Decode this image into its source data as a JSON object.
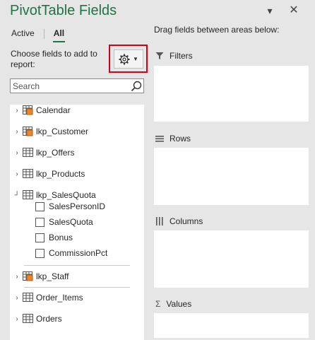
{
  "header": {
    "title": "PivotTable Fields",
    "collapse_icon": "▾",
    "close_icon": "✕"
  },
  "tabs": [
    {
      "label": "Active",
      "active": false
    },
    {
      "label": "All",
      "active": true
    }
  ],
  "choose_label": "Choose fields to add to report:",
  "search": {
    "placeholder": "Search"
  },
  "fields": [
    {
      "name": "Calendar",
      "expander": "›",
      "icon": "table-linked"
    },
    {
      "name": "lkp_Customer",
      "expander": "›",
      "icon": "table-linked"
    },
    {
      "name": "lkp_Offers",
      "expander": "›",
      "icon": "table"
    },
    {
      "name": "lkp_Products",
      "expander": "›",
      "icon": "table"
    },
    {
      "name": "lkp_SalesQuota",
      "expander": "┘",
      "icon": "table",
      "subfields": [
        "SalesPersonID",
        "SalesQuota",
        "Bonus",
        "CommissionPct"
      ]
    },
    {
      "name": "lkp_Staff",
      "expander": "›",
      "icon": "table-linked"
    },
    {
      "name": "Order_Items",
      "expander": "›",
      "icon": "table"
    },
    {
      "name": "Orders",
      "expander": "›",
      "icon": "table"
    }
  ],
  "areas": {
    "instruction": "Drag fields between areas below:",
    "filters": "Filters",
    "rows": "Rows",
    "columns": "Columns",
    "values": "Values",
    "values_symbol": "Σ"
  },
  "colors": {
    "accent": "#217346",
    "highlight": "#d0021b",
    "linked_table": "#e8862c"
  }
}
